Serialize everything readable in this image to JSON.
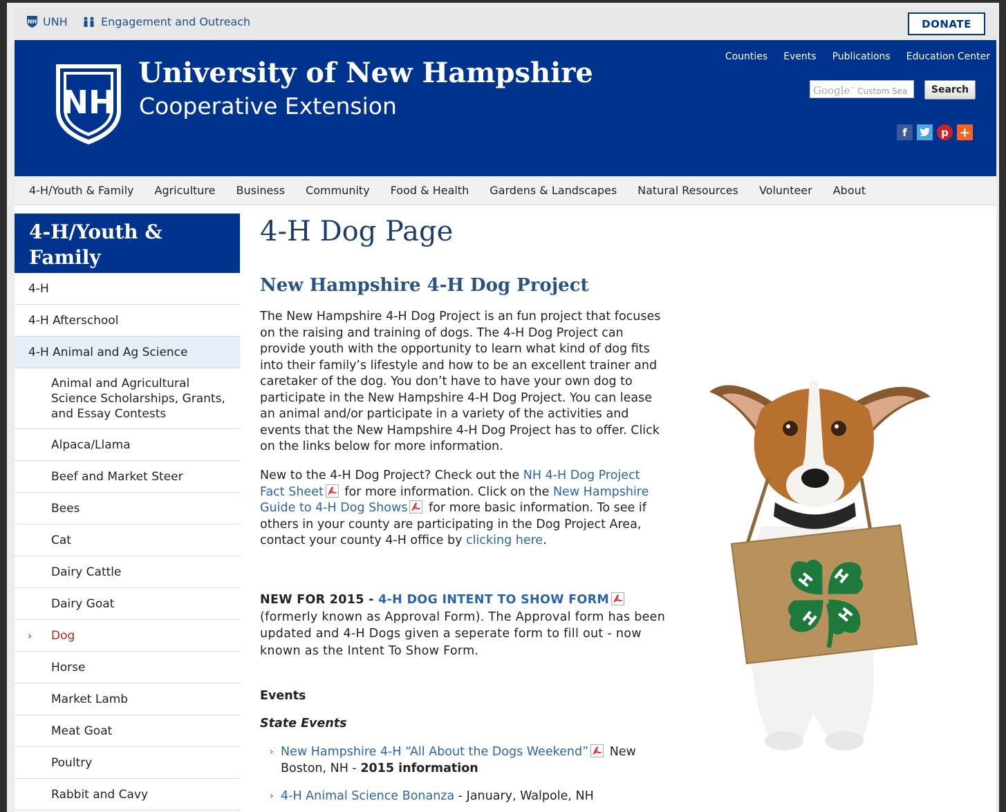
{
  "utility": {
    "unh_label": "UNH",
    "engagement_label": "Engagement and Outreach",
    "donate_label": "DONATE"
  },
  "header": {
    "university": "University of New Hampshire",
    "subtitle": "Cooperative Extension",
    "top_links": [
      "Counties",
      "Events",
      "Publications",
      "Education Center"
    ],
    "search_google": "Google",
    "search_placeholder": "Custom Sea",
    "search_button": "Search",
    "social_icons": [
      "facebook-icon",
      "twitter-icon",
      "pinterest-icon",
      "share-plus-icon"
    ]
  },
  "nav": {
    "items": [
      "4-H/Youth & Family",
      "Agriculture",
      "Business",
      "Community",
      "Food & Health",
      "Gardens & Landscapes",
      "Natural Resources",
      "Volunteer",
      "About"
    ]
  },
  "sidebar": {
    "heading": "4-H/Youth & Family",
    "items": [
      {
        "label": "4-H",
        "level": 1
      },
      {
        "label": "4-H Afterschool",
        "level": 1
      },
      {
        "label": "4-H Animal and Ag Science",
        "level": 1
      },
      {
        "label": "Animal and Agricultural Science Scholarships, Grants, and Essay Contests",
        "level": 2
      },
      {
        "label": "Alpaca/Llama",
        "level": 2
      },
      {
        "label": "Beef and Market Steer",
        "level": 2
      },
      {
        "label": "Bees",
        "level": 2
      },
      {
        "label": "Cat",
        "level": 2
      },
      {
        "label": "Dairy Cattle",
        "level": 2
      },
      {
        "label": "Dairy Goat",
        "level": 2
      },
      {
        "label": "Dog",
        "level": 2
      },
      {
        "label": "Horse",
        "level": 2
      },
      {
        "label": "Market Lamb",
        "level": 2
      },
      {
        "label": "Meat Goat",
        "level": 2
      },
      {
        "label": "Poultry",
        "level": 2
      },
      {
        "label": "Rabbit and Cavy",
        "level": 2
      }
    ]
  },
  "content": {
    "title": "4-H Dog Page",
    "subtitle": "New Hampshire 4-H Dog Project",
    "intro": "The New Hampshire 4-H Dog Project is an fun project that focuses on the raising and training of dogs. The 4-H Dog Project can provide youth with the opportunity to learn what kind of dog fits into their family’s lifestyle and how to be an excellent trainer and caretaker of the dog. You don’t have to have your own dog to participate in the New Hampshire 4-H Dog Project. You can lease an animal and/or participate in a variety of the activities and events that the New Hampshire 4-H Dog Project has to offer. Click on the links below for more information.",
    "p2_a": "New to the 4-H Dog Project? Check out the ",
    "p2_link1": "NH 4-H Dog Project Fact Sheet",
    "p2_b": " for more information. Click on the ",
    "p2_link2": "New Hampshire Guide to 4-H Dog Shows",
    "p2_c": " for more basic information. To see if others in your county are participating in the Dog Project Area, contact your county 4-H office by ",
    "p2_link3": "clicking here",
    "p2_d": ".",
    "new_prefix": "NEW FOR 2015",
    "new_sep": " - ",
    "new_link": "4-H DOG INTENT TO SHOW FORM",
    "new_rest": " (formerly known as Approval Form).  The Approval form has been updated and 4-H Dogs given a seperate form to fill out - now known as the Intent To Show Form.",
    "events_heading": "Events",
    "state_events_heading": "State Events",
    "event1_link": "New Hampshire 4-H “All About the Dogs Weekend”",
    "event1_rest": " New Boston, NH - ",
    "event1_bold": "2015 information",
    "event2_link": "4-H Animal Science Bonanza",
    "event2_rest": " - January, Walpole, NH"
  },
  "colors": {
    "unh_blue": "#00338d",
    "link": "#2a64ab",
    "current_red": "#a0301b",
    "clover_green": "#1e7a3c"
  }
}
